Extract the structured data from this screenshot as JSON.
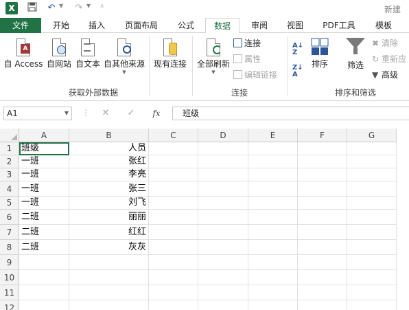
{
  "window": {
    "title": "新建",
    "app_logo": "X",
    "quick_access": [
      "save-icon",
      "undo-icon",
      "redo-icon",
      "customize-icon"
    ]
  },
  "tabs": {
    "file": "文件",
    "items": [
      "开始",
      "插入",
      "页面布局",
      "公式",
      "数据",
      "审阅",
      "视图",
      "PDF工具",
      "模板"
    ],
    "active": "数据"
  },
  "ribbon": {
    "external": {
      "from_access": "自 Access",
      "from_web": "自网站",
      "from_text": "自文本",
      "from_other": "自其他来源",
      "existing": "现有连接",
      "label": "获取外部数据"
    },
    "connections": {
      "refresh_all": "全部刷新",
      "connections": "连接",
      "properties": "属性",
      "edit_links": "编辑链接",
      "label": "连接"
    },
    "sort_filter": {
      "sort": "排序",
      "filter": "筛选",
      "clear": "清除",
      "reapply": "重新应",
      "advanced": "高级",
      "label": "排序和筛选"
    }
  },
  "formula_bar": {
    "name_box": "A1",
    "cancel_icon": "✕",
    "enter_icon": "✓",
    "fx_label": "fx",
    "content": "班级"
  },
  "sheet": {
    "columns": [
      "A",
      "B",
      "C",
      "D",
      "E",
      "F",
      "G"
    ],
    "rows": [
      "1",
      "2",
      "3",
      "4",
      "5",
      "6",
      "7",
      "8",
      "9",
      "10",
      "11",
      "12"
    ],
    "cells": [
      [
        "班级",
        "人员"
      ],
      [
        "一班",
        "张红"
      ],
      [
        "一班",
        "李亮"
      ],
      [
        "一班",
        "张三"
      ],
      [
        "一班",
        "刘飞"
      ],
      [
        "二班",
        "丽丽"
      ],
      [
        "二班",
        "红红"
      ],
      [
        "二班",
        "灰灰"
      ],
      [
        "",
        ""
      ],
      [
        "",
        ""
      ],
      [
        "",
        ""
      ],
      [
        "",
        ""
      ]
    ],
    "selected_cell": "A1",
    "accent_color": "#217346"
  }
}
